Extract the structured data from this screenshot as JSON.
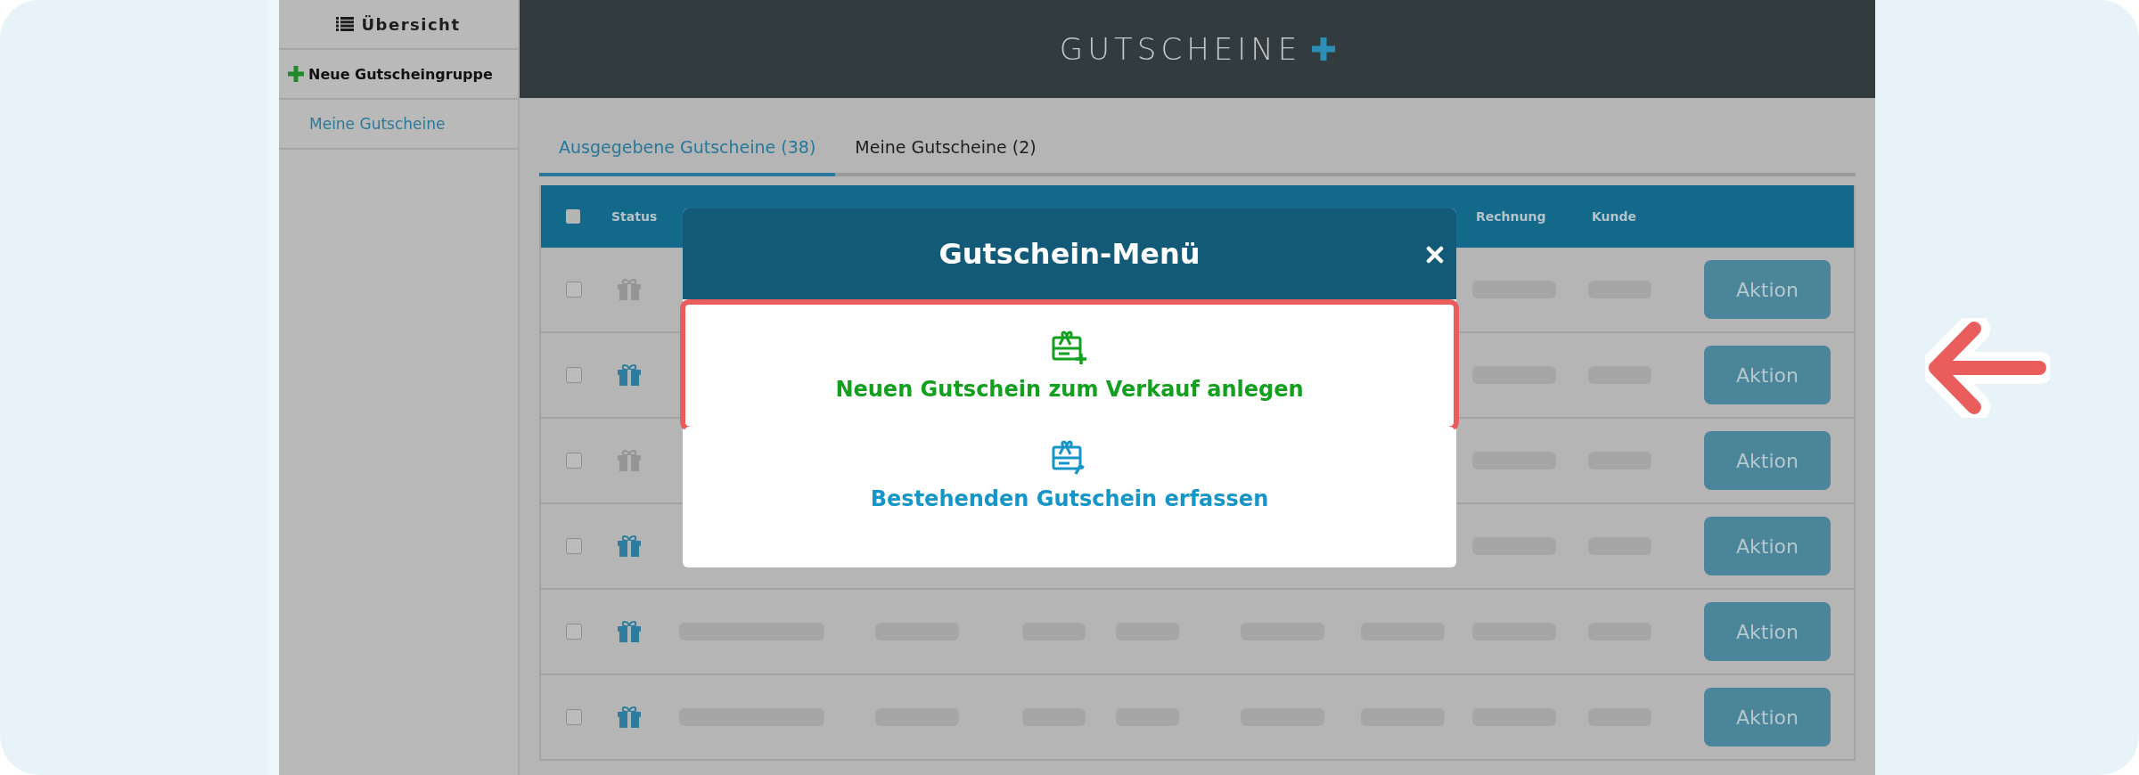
{
  "sidebar": {
    "items": [
      {
        "kind": "heading",
        "label": "Übersicht"
      },
      {
        "kind": "add",
        "label": "Neue Gutscheingruppe"
      },
      {
        "kind": "link",
        "label": "Meine Gutscheine"
      }
    ]
  },
  "header": {
    "title": "GUTSCHEINE"
  },
  "tabs": [
    {
      "label": "Ausgegebene Gutscheine (38)",
      "selected": true
    },
    {
      "label": "Meine Gutscheine (2)",
      "selected": false
    }
  ],
  "table": {
    "select_all_checked": false,
    "columns": [
      {
        "label": "Status"
      },
      {
        "label": "Rechnung"
      },
      {
        "label": "Kunde"
      }
    ],
    "rows": [
      {
        "checked": false,
        "active": false,
        "action": "Aktion"
      },
      {
        "checked": false,
        "active": true,
        "action": "Aktion"
      },
      {
        "checked": false,
        "active": false,
        "action": "Aktion"
      },
      {
        "checked": false,
        "active": true,
        "action": "Aktion"
      },
      {
        "checked": false,
        "active": true,
        "action": "Aktion"
      },
      {
        "checked": false,
        "active": true,
        "action": "Aktion"
      }
    ]
  },
  "modal": {
    "title": "Gutschein-Menü",
    "options": [
      {
        "kind": "create",
        "label": "Neuen Gutschein zum Verkauf anlegen",
        "highlighted": true
      },
      {
        "kind": "import",
        "label": "Bestehenden Gutschein erfassen",
        "highlighted": false
      }
    ]
  }
}
